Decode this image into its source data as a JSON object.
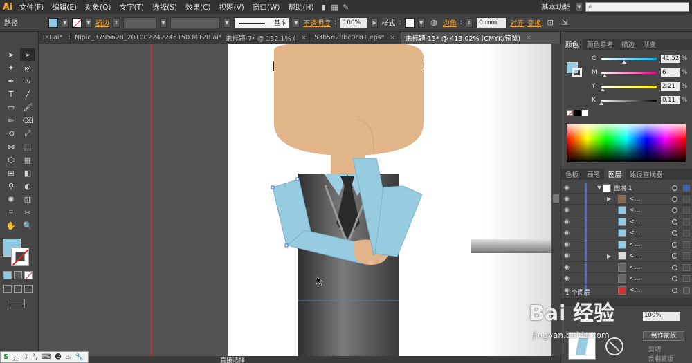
{
  "app": {
    "logo": "Ai"
  },
  "menu": [
    "文件(F)",
    "编辑(E)",
    "对象(O)",
    "文字(T)",
    "选择(S)",
    "效果(C)",
    "视图(V)",
    "窗口(W)",
    "帮助(H)"
  ],
  "workspace_label": "基本功能",
  "control": {
    "object_type": "路径",
    "stroke_label": "描边",
    "stroke_style": "基本",
    "opacity_label": "不透明度",
    "opacity_value": "100%",
    "style_label": "样式",
    "corner_label": "边角",
    "corner_value": "0 mm",
    "align_label": "对齐",
    "transform_label": "变换",
    "fill_color": "#8fcbe2"
  },
  "tabs": [
    {
      "label": "00.ai*",
      "active": false
    },
    {
      "label": "Nipic_3795628_20100224224515034128.ai*",
      "active": false
    },
    {
      "label": "未标题-7* @ 132.1% (",
      "active": false
    },
    {
      "label": "53b5d28bc0c81.eps*",
      "active": false
    },
    {
      "label": "未标题-13* @ 413.02% (CMYK/预览)",
      "active": true
    }
  ],
  "color_panel": {
    "tabs": [
      "颜色",
      "颜色参考",
      "描边",
      "渐变"
    ],
    "channels": [
      {
        "label": "C",
        "value": "41.52",
        "pct": 0.4152
      },
      {
        "label": "M",
        "value": "6",
        "pct": 0.06
      },
      {
        "label": "Y",
        "value": "2.21",
        "pct": 0.0221
      },
      {
        "label": "K",
        "value": "0.11",
        "pct": 0.0011
      }
    ]
  },
  "layers_panel": {
    "tabs": [
      "色板",
      "画笔",
      "图层",
      "路径查找器"
    ],
    "layer_name": "图层 1",
    "sublayer_label": "<...",
    "footer": "1 个图层"
  },
  "lower_panel": {
    "opacity_value": "100%",
    "make_mask_btn": "制作蒙版",
    "clip_label": "剪切",
    "invert_label": "反相蒙版"
  },
  "status": {
    "tool": "直接选择"
  },
  "watermark": {
    "main": "Bai 经验",
    "sub": "jingyan.baidu.com"
  }
}
